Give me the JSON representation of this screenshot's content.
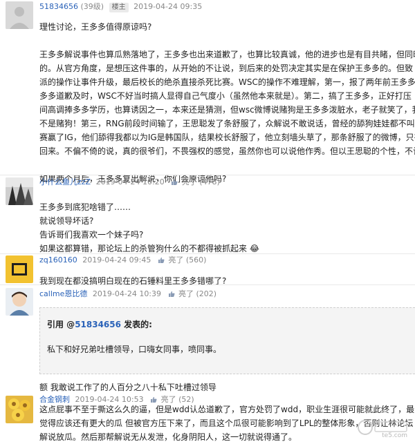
{
  "posts": [
    {
      "user": "51834656",
      "level": "(39级)",
      "badge": "楼主",
      "time": "2019-04-24 09:35",
      "paragraphs": [
        "理性讨论，王多多值得原谅吗?",
        "",
        "王多多解说事件也算瓜熟落地了，王多多也出来道歉了，也算比较真诚，他的进步也是有目共睹，但同时",
        "的。从官方角度，是想压这件事的，从开始的不让说，到后来的处罚决定其实是在保护王多多的。但致",
        "派的操作让事件升级，最后校长的绝杀直接杀死比赛。WSC的操作不难理解，第一，报了两年前王多多",
        "多多道歉及时，WSC不好当时搞人显得自己气度小（虽然他本来就是）。第二，搞了王多多，正好打压",
        "间高调捧多多学历，也算诱因之一，本来还是猜测，但wsc微博说赌狗是王多多泼脏水，老子就笑了，我",
        "不是赌狗！第三，RNG前段时间输了，王思聪发了条舒服了，众解说不敢说话，曾经的舔狗娃娃都不叫",
        "赛赢了IG，他们舔得我都以为IG是韩国队，结果校长舒服了，他立刻墙头草了，那条舒服了的微博，只有",
        "回来。不偏不倚的说，真的很爷们，不畏强权的感觉，虽然你也可以说他作秀。但以王思聪的个性，不让",
        "",
        "如果两个月后，王多多复出解说，你们会原谅他吗?"
      ]
    },
    {
      "user": "小什么鱼儿zzZ",
      "time": "2019-04-24 10:20",
      "like_label": "亮了",
      "likes": "(478)",
      "paragraphs": [
        "王多多到底犯啥错了……",
        "就说领导坏话?",
        "告诉哥们我喜欢一个妹子吗?",
        "如果这都算错，那论坛上的杀管狗什么的不都得被抓起来 😂"
      ]
    },
    {
      "user": "zq160160",
      "time": "2019-04-24 09:45",
      "like_label": "亮了",
      "likes": "(560)",
      "paragraphs": [
        "我到现在都没搞明白现在的石锤料里王多多错哪了?"
      ]
    },
    {
      "user": "callme恩比德",
      "time": "2019-04-24 10:39",
      "like_label": "亮了",
      "likes": "(202)",
      "quote": {
        "prefix": "引用 @",
        "user": "51834656",
        "suffix": " 发表的:",
        "body": "私下和好兄弟吐槽领导，口嗨女同事，喷同事。"
      },
      "paragraphs": [
        "额 我敢说工作了的人百分之八十私下吐槽过领导"
      ]
    },
    {
      "user": "合金钢刺",
      "time": "2019-04-24 10:53",
      "like_label": "亮了",
      "likes": "(52)",
      "paragraphs": [
        "这点屁事不至于撕这么久的逼，但是wdd认怂道歉了，官方处罚了wdd，职业生涯很可能就此终了，最",
        "觉得应该还有更大的瓜 但被官方压下来了，而且这个瓜很可能影响到了LPL的整体形象，否则让林论坛",
        "解说放瓜。然后那帮解说无从发泄，化身阴阳人，这一切就说得通了。"
      ]
    }
  ],
  "watermark": "te5.com"
}
